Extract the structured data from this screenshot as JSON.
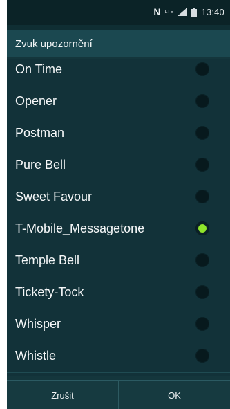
{
  "status_bar": {
    "network": "N",
    "lte": "LTE",
    "time": "13:40"
  },
  "dialog": {
    "title": "Zvuk upozornění",
    "items": [
      {
        "label": "On Time",
        "selected": false
      },
      {
        "label": "Opener",
        "selected": false
      },
      {
        "label": "Postman",
        "selected": false
      },
      {
        "label": "Pure Bell",
        "selected": false
      },
      {
        "label": "Sweet Favour",
        "selected": false
      },
      {
        "label": "T-Mobile_Messagetone",
        "selected": true
      },
      {
        "label": "Temple Bell",
        "selected": false
      },
      {
        "label": "Tickety-Tock",
        "selected": false
      },
      {
        "label": "Whisper",
        "selected": false
      },
      {
        "label": "Whistle",
        "selected": false
      }
    ],
    "buttons": {
      "cancel": "Zrušit",
      "ok": "OK"
    }
  },
  "colors": {
    "accent": "#8fe52b"
  }
}
